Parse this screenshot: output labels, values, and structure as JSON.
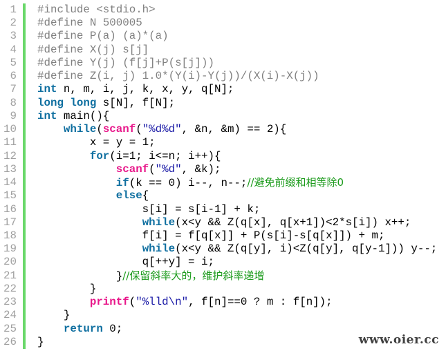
{
  "editor": {
    "gutter_color": "#6ad86a",
    "lines": [
      {
        "n": "1",
        "tokens": [
          {
            "t": "pp",
            "v": "#include <stdio.h>"
          }
        ]
      },
      {
        "n": "2",
        "tokens": [
          {
            "t": "pp",
            "v": "#define N 500005"
          }
        ]
      },
      {
        "n": "3",
        "tokens": [
          {
            "t": "pp",
            "v": "#define P(a) (a)*(a)"
          }
        ]
      },
      {
        "n": "4",
        "tokens": [
          {
            "t": "pp",
            "v": "#define X(j) s[j]"
          }
        ]
      },
      {
        "n": "5",
        "tokens": [
          {
            "t": "pp",
            "v": "#define Y(j) (f[j]+P(s[j]))"
          }
        ]
      },
      {
        "n": "6",
        "tokens": [
          {
            "t": "pp",
            "v": "#define Z(i, j) 1.0*(Y(i)-Y(j))/(X(i)-X(j))"
          }
        ]
      },
      {
        "n": "7",
        "tokens": [
          {
            "t": "kw",
            "v": "int"
          },
          {
            "t": "tx",
            "v": " n, m, i, j, k, x, y, q[N];"
          }
        ]
      },
      {
        "n": "8",
        "tokens": [
          {
            "t": "kw",
            "v": "long long"
          },
          {
            "t": "tx",
            "v": " s[N], f[N];"
          }
        ]
      },
      {
        "n": "9",
        "tokens": [
          {
            "t": "kw",
            "v": "int"
          },
          {
            "t": "tx",
            "v": " main(){"
          }
        ]
      },
      {
        "n": "10",
        "tokens": [
          {
            "t": "tx",
            "v": "    "
          },
          {
            "t": "kw",
            "v": "while"
          },
          {
            "t": "tx",
            "v": "("
          },
          {
            "t": "fn",
            "v": "scanf"
          },
          {
            "t": "tx",
            "v": "("
          },
          {
            "t": "str",
            "v": "\"%d%d\""
          },
          {
            "t": "tx",
            "v": ", &n, &m) == 2){"
          }
        ]
      },
      {
        "n": "11",
        "tokens": [
          {
            "t": "tx",
            "v": "        x = y = 1;"
          }
        ]
      },
      {
        "n": "12",
        "tokens": [
          {
            "t": "tx",
            "v": "        "
          },
          {
            "t": "kw",
            "v": "for"
          },
          {
            "t": "tx",
            "v": "(i=1; i<=n; i++){"
          }
        ]
      },
      {
        "n": "13",
        "tokens": [
          {
            "t": "tx",
            "v": "            "
          },
          {
            "t": "fn",
            "v": "scanf"
          },
          {
            "t": "tx",
            "v": "("
          },
          {
            "t": "str",
            "v": "\"%d\""
          },
          {
            "t": "tx",
            "v": ", &k);"
          }
        ]
      },
      {
        "n": "14",
        "tokens": [
          {
            "t": "tx",
            "v": "            "
          },
          {
            "t": "kw",
            "v": "if"
          },
          {
            "t": "tx",
            "v": "(k == 0) i--, n--;"
          },
          {
            "t": "cm",
            "v": "//避免前缀和相等除0"
          }
        ]
      },
      {
        "n": "15",
        "tokens": [
          {
            "t": "tx",
            "v": "            "
          },
          {
            "t": "kw",
            "v": "else"
          },
          {
            "t": "tx",
            "v": "{"
          }
        ]
      },
      {
        "n": "16",
        "tokens": [
          {
            "t": "tx",
            "v": "                s[i] = s[i-1] + k;"
          }
        ]
      },
      {
        "n": "17",
        "tokens": [
          {
            "t": "tx",
            "v": "                "
          },
          {
            "t": "kw",
            "v": "while"
          },
          {
            "t": "tx",
            "v": "(x<y && Z(q[x], q[x+1])<2*s[i]) x++;"
          }
        ]
      },
      {
        "n": "18",
        "tokens": [
          {
            "t": "tx",
            "v": "                f[i] = f[q[x]] + P(s[i]-s[q[x]]) + m;"
          }
        ]
      },
      {
        "n": "19",
        "tokens": [
          {
            "t": "tx",
            "v": "                "
          },
          {
            "t": "kw",
            "v": "while"
          },
          {
            "t": "tx",
            "v": "(x<y && Z(q[y], i)<Z(q[y], q[y-1])) y--;"
          }
        ]
      },
      {
        "n": "20",
        "tokens": [
          {
            "t": "tx",
            "v": "                q[++y] = i;"
          }
        ]
      },
      {
        "n": "21",
        "tokens": [
          {
            "t": "tx",
            "v": "            }"
          },
          {
            "t": "cm",
            "v": "//保留斜率大的，维护斜率递增"
          }
        ]
      },
      {
        "n": "22",
        "tokens": [
          {
            "t": "tx",
            "v": "        }"
          }
        ]
      },
      {
        "n": "23",
        "tokens": [
          {
            "t": "tx",
            "v": "        "
          },
          {
            "t": "fn",
            "v": "printf"
          },
          {
            "t": "tx",
            "v": "("
          },
          {
            "t": "str",
            "v": "\"%lld\\n\""
          },
          {
            "t": "tx",
            "v": ", f[n]==0 ? m : f[n]);"
          }
        ]
      },
      {
        "n": "24",
        "tokens": [
          {
            "t": "tx",
            "v": "    }"
          }
        ]
      },
      {
        "n": "25",
        "tokens": [
          {
            "t": "tx",
            "v": "    "
          },
          {
            "t": "kw",
            "v": "return"
          },
          {
            "t": "tx",
            "v": " 0;"
          }
        ]
      },
      {
        "n": "26",
        "tokens": [
          {
            "t": "tx",
            "v": "}"
          }
        ]
      }
    ]
  },
  "watermark": "www.oier.cc"
}
